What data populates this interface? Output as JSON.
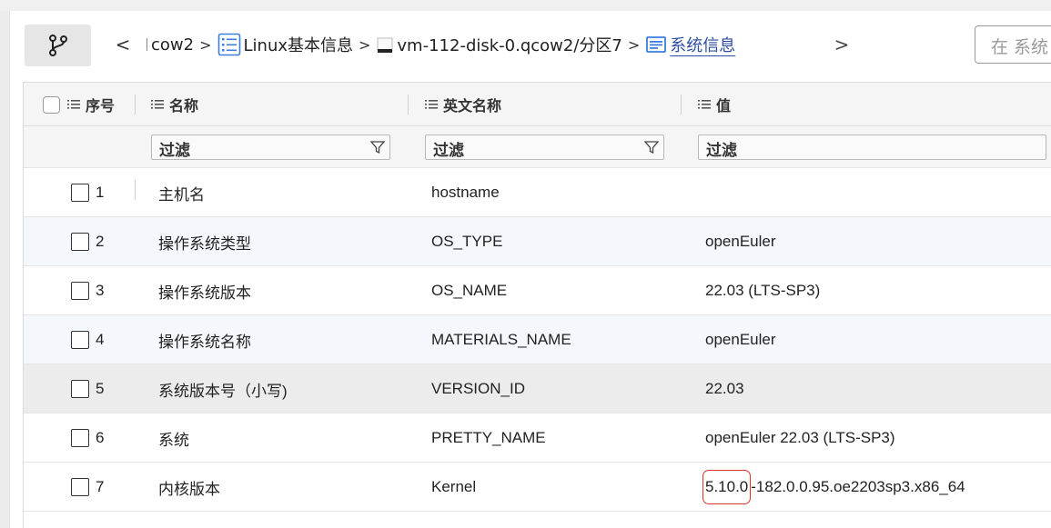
{
  "toolbar": {
    "back_glyph": "<",
    "forward_glyph": ">",
    "breadcrumb": [
      {
        "label": "cow2",
        "icon": "",
        "active": false
      },
      {
        "label": "Linux基本信息",
        "icon": "list-icon",
        "active": false
      },
      {
        "label": "vm-112-disk-0.qcow2/分区7",
        "icon": "disk-icon",
        "active": false
      },
      {
        "label": "系统信息",
        "icon": "info-icon",
        "active": true
      }
    ],
    "separator": ">",
    "search_text": "在 系统"
  },
  "table": {
    "headers": {
      "index": "序号",
      "name": "名称",
      "english_name": "英文名称",
      "value": "值"
    },
    "filter_placeholder": "过滤",
    "rows": [
      {
        "index": "1",
        "name": "主机名",
        "english_name": "hostname",
        "value": "",
        "value_rest": ""
      },
      {
        "index": "2",
        "name": "操作系统类型",
        "english_name": "OS_TYPE",
        "value": "openEuler",
        "value_rest": ""
      },
      {
        "index": "3",
        "name": "操作系统版本",
        "english_name": "OS_NAME",
        "value": "22.03 (LTS-SP3)",
        "value_rest": ""
      },
      {
        "index": "4",
        "name": "操作系统名称",
        "english_name": "MATERIALS_NAME",
        "value": "openEuler",
        "value_rest": ""
      },
      {
        "index": "5",
        "name": "系统版本号（小写)",
        "english_name": "VERSION_ID",
        "value": "22.03",
        "value_rest": ""
      },
      {
        "index": "6",
        "name": "系统",
        "english_name": "PRETTY_NAME",
        "value": "openEuler 22.03 (LTS-SP3)",
        "value_rest": ""
      },
      {
        "index": "7",
        "name": "内核版本",
        "english_name": "Kernel",
        "value": "5.10.0",
        "value_rest": "-182.0.0.95.oe2203sp3.x86_64"
      }
    ]
  },
  "colors": {
    "accent": "#2f4ea3",
    "icon_blue": "#3b7de0",
    "highlight": "#e0342c"
  }
}
